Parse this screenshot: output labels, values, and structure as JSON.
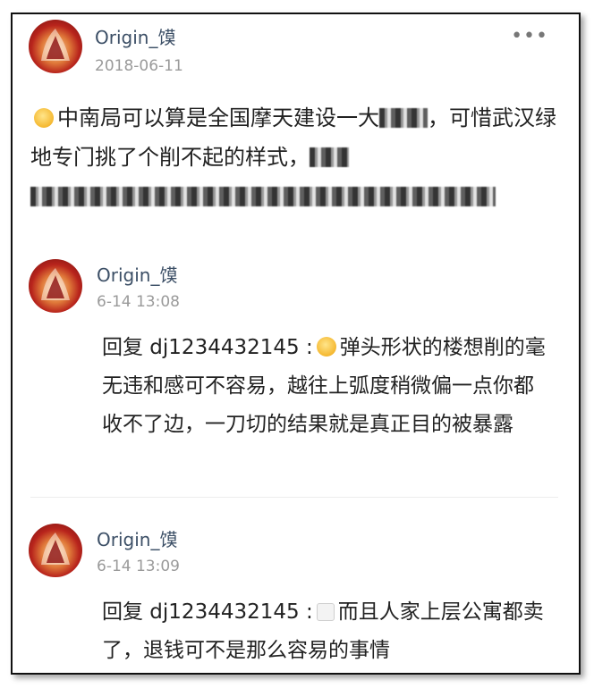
{
  "post": {
    "author": "Origin_馍",
    "date": "2018-06-11",
    "more_icon": "•••",
    "text_a": "中南局可以算是全国摩天建设一大",
    "text_b": "，可惜武汉绿地专门挑了个削不起的样式，"
  },
  "replies": [
    {
      "author": "Origin_馍",
      "time": "6-14 13:08",
      "prefix": "回复 dj1234432145 :",
      "text": "弹头形状的楼想削的毫无违和感可不容易，越往上弧度稍微偏一点你都收不了边，一刀切的结果就是真正目的被暴露"
    },
    {
      "author": "Origin_馍",
      "time": "6-14 13:09",
      "prefix": "回复 dj1234432145 :",
      "text": "而且人家上层公寓都卖了，退钱可不是那么容易的事情"
    }
  ]
}
